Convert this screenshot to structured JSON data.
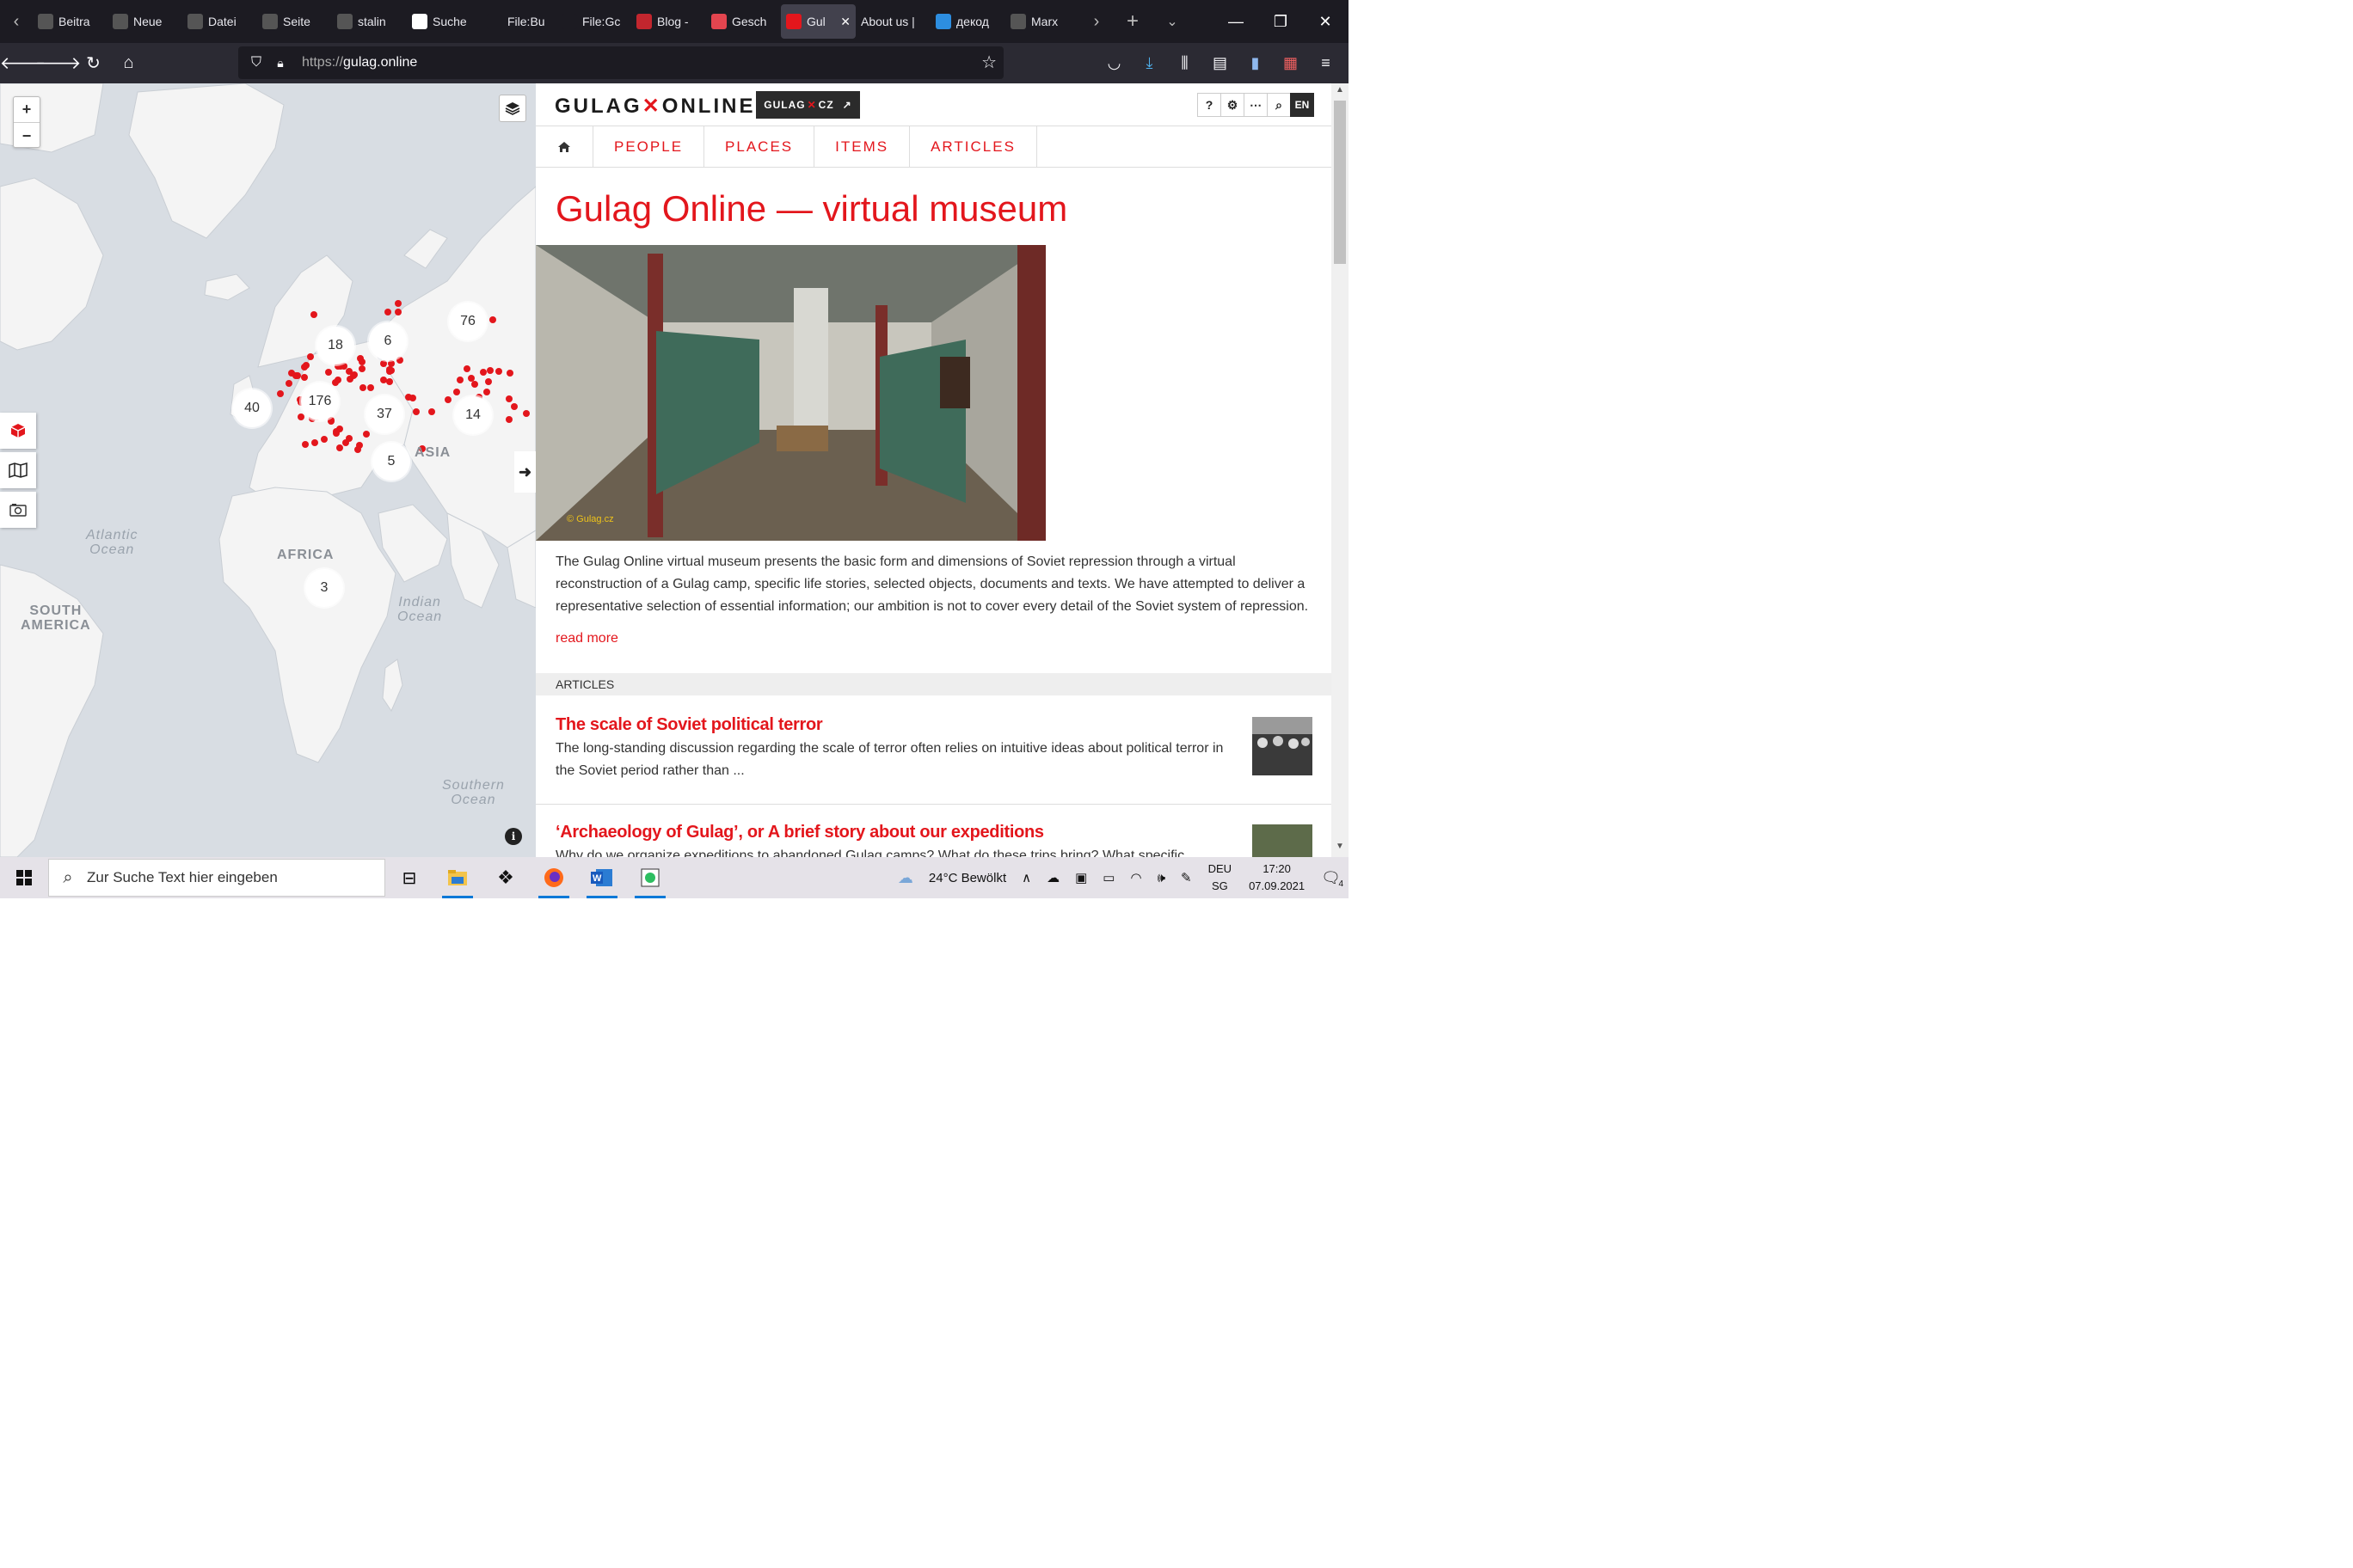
{
  "browser": {
    "tabs": [
      {
        "label": "Beitra",
        "fav": "#555"
      },
      {
        "label": "Neue",
        "fav": "#555"
      },
      {
        "label": "Datei",
        "fav": "#555"
      },
      {
        "label": "Seite",
        "fav": "#555"
      },
      {
        "label": "stalin",
        "fav": "#555"
      },
      {
        "label": "Suche",
        "fav": "#fff"
      },
      {
        "label": "File:Bu",
        "fav": "#1c1b22"
      },
      {
        "label": "File:Gc",
        "fav": "#1c1b22"
      },
      {
        "label": "Blog -",
        "fav": "#c2262e"
      },
      {
        "label": "Gesch",
        "fav": "#e3454f"
      },
      {
        "label": "Gul",
        "fav": "#e3161c",
        "active": true
      },
      {
        "label": "About us |",
        "fav": ""
      },
      {
        "label": "декод",
        "fav": "#2d8ee0"
      },
      {
        "label": "Marx",
        "fav": "#555"
      }
    ],
    "url_protocol": "https://",
    "url_host": "gulag.online"
  },
  "map": {
    "clusters": [
      {
        "n": "76"
      },
      {
        "n": "18"
      },
      {
        "n": "6"
      },
      {
        "n": "40"
      },
      {
        "n": "176"
      },
      {
        "n": "37"
      },
      {
        "n": "14"
      },
      {
        "n": "5"
      },
      {
        "n": "3"
      }
    ],
    "labels": {
      "africa": "AFRICA",
      "asia": "ASIA",
      "south_america": "SOUTH\nAMERICA",
      "atlantic": "Atlantic\nOcean",
      "indian": "Indian\nOcean",
      "southern": "Southern\nOcean"
    },
    "zoom_in": "+",
    "zoom_out": "−",
    "info": "i",
    "colors": {
      "marker": "#e3161c",
      "land": "#f4f4f4",
      "water": "#d8dde3"
    }
  },
  "site": {
    "logo_left": "GULAG",
    "logo_x": "✕",
    "logo_right": "ONLINE",
    "cz_left": "GULAG",
    "cz_x": "✕",
    "cz_right": "CZ",
    "header_icons": {
      "help": "?",
      "lang": "EN"
    },
    "menu": [
      "PEOPLE",
      "PLACES",
      "ITEMS",
      "ARTICLES"
    ],
    "title": "Gulag Online — virtual museum",
    "hero_caption": "© Gulag.cz",
    "intro": "The Gulag Online virtual museum presents the basic form and dimensions of Soviet repression through a virtual reconstruction of a Gulag camp, specific life stories, selected objects, documents and texts. We have attempted to deliver a representative selection of essential information; our ambition is not to cover every detail of the Soviet system of repression.",
    "read_more": "read more",
    "section_label": "ARTICLES",
    "articles": [
      {
        "title": "The scale of Soviet political terror",
        "excerpt": "The long-standing discussion regarding the scale of terror often relies on intuitive ideas about political terror in the Soviet period rather than ..."
      },
      {
        "title": "‘Archaeology of Gulag’, or A brief story about our expeditions",
        "excerpt": "Why do we organize expeditions to abandoned Gulag camps? What do these trips bring? What specific conclusions"
      }
    ],
    "accent": "#e3161c"
  },
  "taskbar": {
    "search_placeholder": "Zur Suche Text hier eingeben",
    "weather": "24°C  Bewölkt",
    "lang_top": "DEU",
    "lang_bottom": "SG",
    "time": "17:20",
    "date": "07.09.2021",
    "notifications": "4"
  }
}
